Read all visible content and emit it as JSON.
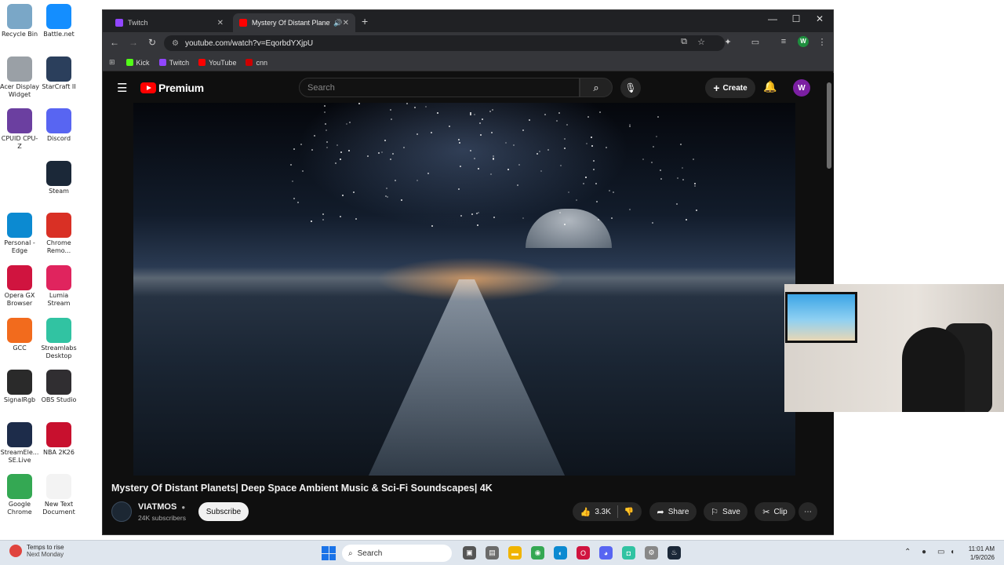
{
  "desktop_icons": [
    {
      "label": "Recycle Bin",
      "color": "#7aa7c7"
    },
    {
      "label": "Battle.net",
      "color": "#148eff"
    },
    {
      "label": "Acer Display Widget",
      "color": "#9aa0a6"
    },
    {
      "label": "StarCraft II",
      "color": "#2b3f5c"
    },
    {
      "label": "CPUID CPU-Z",
      "color": "#6b3fa0"
    },
    {
      "label": "Discord",
      "color": "#5865f2"
    },
    {
      "label": "Steam",
      "color": "#1b2838"
    },
    {
      "label": "Personal - Edge",
      "color": "#0c8ad1"
    },
    {
      "label": "Chrome Remo...",
      "color": "#d93025"
    },
    {
      "label": "Opera GX Browser",
      "color": "#d0143f"
    },
    {
      "label": "Lumia Stream",
      "color": "#e0245e"
    },
    {
      "label": "GCC",
      "color": "#f26b1d"
    },
    {
      "label": "Streamlabs Desktop",
      "color": "#31c3a2"
    },
    {
      "label": "SignalRgb",
      "color": "#2a2a2a"
    },
    {
      "label": "OBS Studio",
      "color": "#302e31"
    },
    {
      "label": "StreamEle... SE.Live",
      "color": "#1d2c4a"
    },
    {
      "label": "NBA 2K26",
      "color": "#c8102e"
    },
    {
      "label": "Google Chrome",
      "color": "#34a853"
    },
    {
      "label": "New Text Document",
      "color": "#f3f3f3"
    }
  ],
  "browser": {
    "tabs": [
      {
        "title": "Twitch",
        "favicon_color": "#9146ff"
      },
      {
        "title": "Mystery Of Distant Planets",
        "favicon_color": "#ff0000"
      }
    ],
    "url": "youtube.com/watch?v=EqorbdYXjpU",
    "bookmarks": [
      {
        "label": "Kick",
        "color": "#53fc18"
      },
      {
        "label": "Twitch",
        "color": "#9146ff"
      },
      {
        "label": "YouTube",
        "color": "#ff0000"
      },
      {
        "label": "cnn",
        "color": "#cc0000"
      }
    ],
    "profile_initial": "W"
  },
  "youtube": {
    "logo_text": "Premium",
    "search_placeholder": "Search",
    "create_label": "Create",
    "avatar_initial": "W",
    "video_title": "Mystery Of Distant Planets| Deep Space Ambient Music & Sci-Fi Soundscapes| 4K",
    "channel_name": "VIATMOS",
    "subscribers": "24K subscribers",
    "subscribe_label": "Subscribe",
    "likes": "3.3K",
    "share_label": "Share",
    "save_label": "Save",
    "clip_label": "Clip"
  },
  "taskbar": {
    "weather_line1": "Temps to rise",
    "weather_line2": "Next Monday",
    "search_label": "Search",
    "time": "11:01 AM",
    "date": "1/9/2026"
  }
}
